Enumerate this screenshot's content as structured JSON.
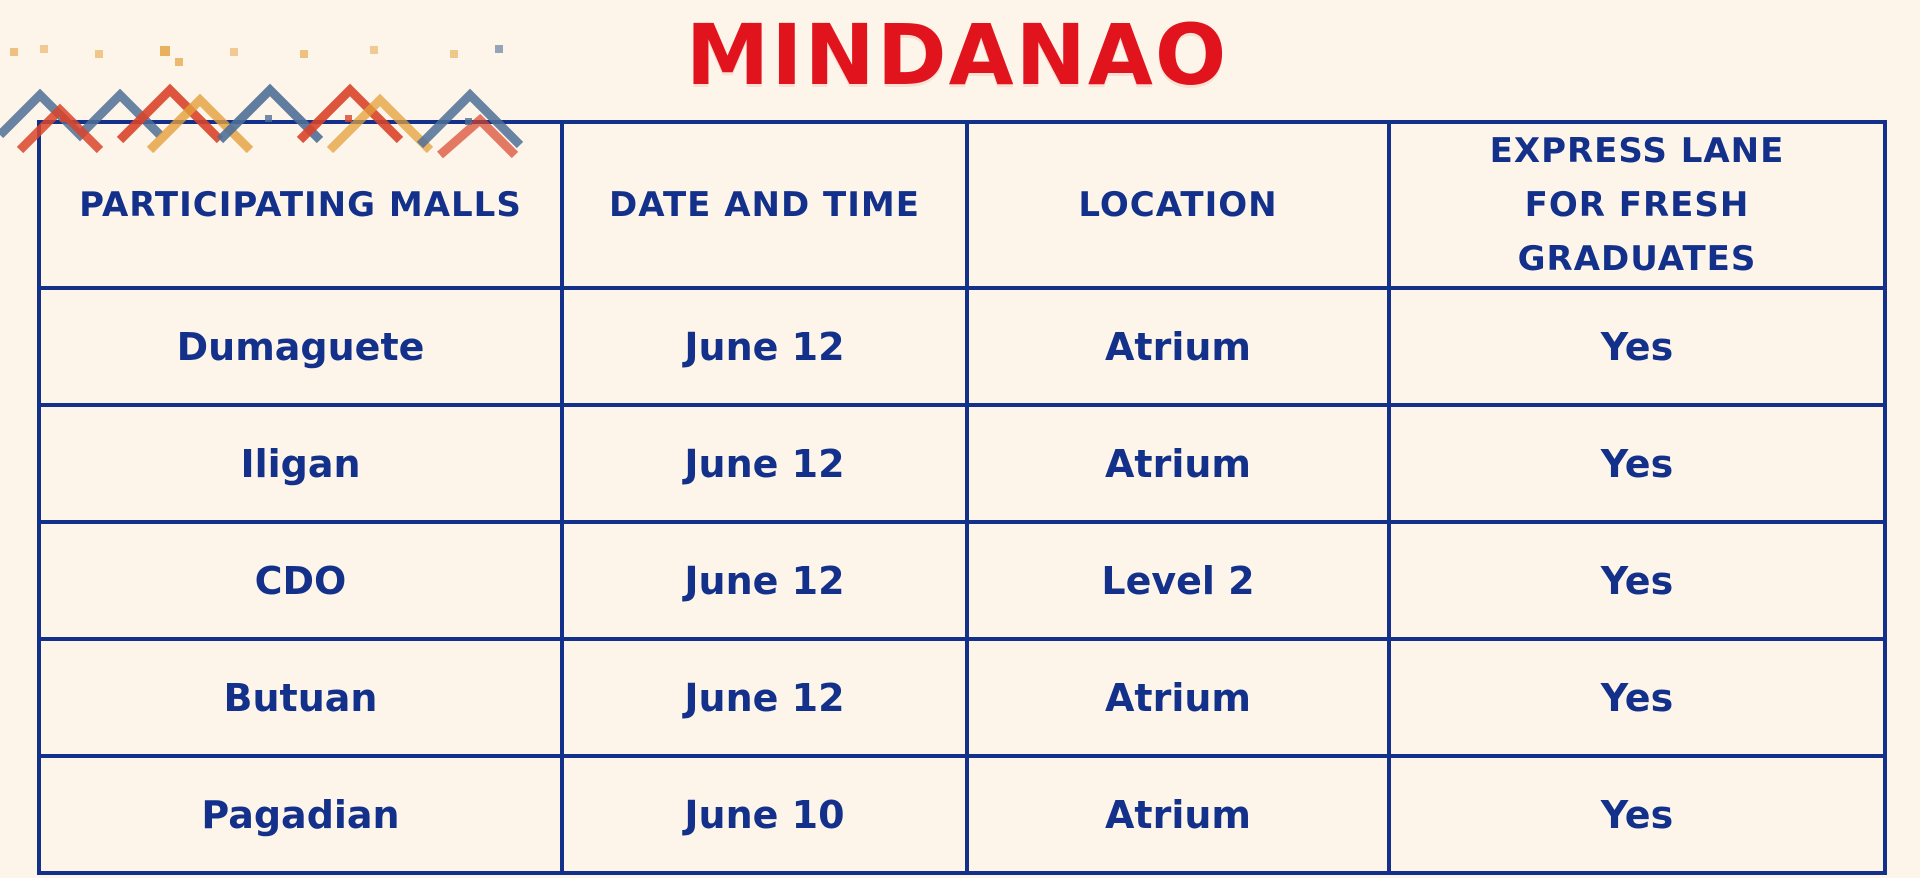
{
  "title": "MINDANAO",
  "colors": {
    "background": "#fdf5ea",
    "title": "#e1141d",
    "table": "#13318a",
    "pattern_red": "#d9442a",
    "pattern_blue": "#4f6f96",
    "pattern_orange": "#e3a03a"
  },
  "decoration": "woven-tribal-pattern",
  "table": {
    "headers": [
      "PARTICIPATING MALLS",
      "DATE AND TIME",
      "LOCATION",
      "EXPRESS LANE FOR FRESH GRADUATES"
    ],
    "rows": [
      [
        "Dumaguete",
        "June 12",
        "Atrium",
        "Yes"
      ],
      [
        "Iligan",
        "June 12",
        "Atrium",
        "Yes"
      ],
      [
        "CDO",
        "June 12",
        "Level 2",
        "Yes"
      ],
      [
        "Butuan",
        "June 12",
        "Atrium",
        "Yes"
      ],
      [
        "Pagadian",
        "June 10",
        "Atrium",
        "Yes"
      ]
    ]
  }
}
